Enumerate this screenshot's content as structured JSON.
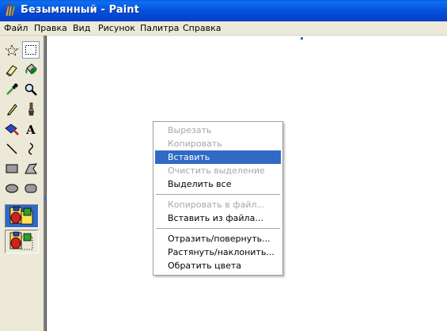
{
  "window": {
    "title": "Безымянный - Paint",
    "app_icon": "paint-palette-icon",
    "titlebar_color": "#0355e0"
  },
  "menubar": {
    "items": [
      "Файл",
      "Правка",
      "Вид",
      "Рисунок",
      "Палитра",
      "Справка"
    ]
  },
  "toolbox": {
    "tools": [
      {
        "name": "free-form-select-icon",
        "selected": false
      },
      {
        "name": "rect-select-icon",
        "selected": true
      },
      {
        "name": "eraser-icon",
        "selected": false
      },
      {
        "name": "fill-bucket-icon",
        "selected": false
      },
      {
        "name": "color-picker-icon",
        "selected": false
      },
      {
        "name": "magnifier-icon",
        "selected": false
      },
      {
        "name": "pencil-icon",
        "selected": false
      },
      {
        "name": "brush-icon",
        "selected": false
      },
      {
        "name": "airbrush-icon",
        "selected": false
      },
      {
        "name": "text-icon",
        "selected": false,
        "glyph": "A"
      },
      {
        "name": "line-icon",
        "selected": false
      },
      {
        "name": "curve-icon",
        "selected": false
      },
      {
        "name": "rectangle-icon",
        "selected": false
      },
      {
        "name": "polygon-icon",
        "selected": false
      },
      {
        "name": "ellipse-icon",
        "selected": false
      },
      {
        "name": "rounded-rect-icon",
        "selected": false
      }
    ],
    "options": [
      {
        "name": "opaque-selection-option",
        "selected": true
      },
      {
        "name": "transparent-selection-option",
        "selected": false
      }
    ]
  },
  "context_menu": {
    "accent": "#316ac5",
    "items": [
      {
        "label": "Вырезать",
        "disabled": true
      },
      {
        "label": "Копировать",
        "disabled": true
      },
      {
        "label": "Вставить",
        "disabled": false,
        "highlighted": true
      },
      {
        "label": "Очистить выделение",
        "disabled": true
      },
      {
        "label": "Выделить все",
        "disabled": false
      },
      {
        "separator": true
      },
      {
        "label": "Копировать в файл...",
        "disabled": true
      },
      {
        "label": "Вставить из файла...",
        "disabled": false
      },
      {
        "separator": true
      },
      {
        "label": "Отразить/повернуть...",
        "disabled": false
      },
      {
        "label": "Растянуть/наклонить...",
        "disabled": false
      },
      {
        "label": "Обратить цвета",
        "disabled": false
      }
    ]
  }
}
